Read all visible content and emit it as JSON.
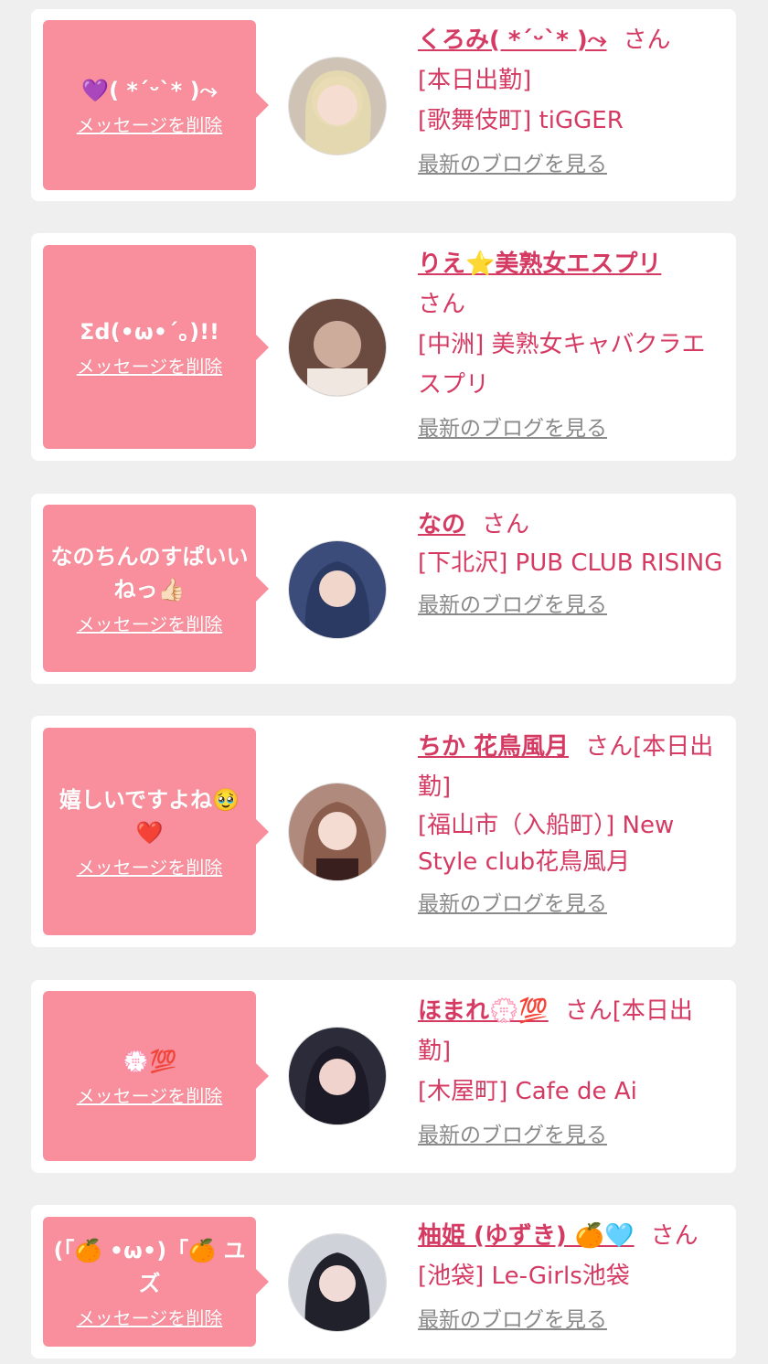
{
  "delete_label": "メッセージを削除",
  "blog_label": "最新のブログを見る",
  "honorific": "さん",
  "colors": {
    "background": "#efefef",
    "bubble": "#f98f9d",
    "accent": "#d53a63",
    "link_gray": "#8a8a8a"
  },
  "messages": [
    {
      "message": "💜( *ˊᵕˋ* )⤳",
      "name": "くろみ( *ˊᵕˋ* )⤳",
      "status": "[本日出勤]",
      "shop": "[歌舞伎町] tiGGER"
    },
    {
      "message": "Σd(•ω•´。)!!",
      "name": "りえ⭐美熟女エスプリ",
      "status": "",
      "shop": "[中洲] 美熟女キャバクラエスプリ"
    },
    {
      "message": "なのちんのすぱいいねっ👍🏻",
      "name": "なの",
      "status": "",
      "shop": "[下北沢] PUB CLUB RISING"
    },
    {
      "message": "嬉しいですよね🥹❤️",
      "name": "ちか 花鳥風月",
      "status": "[本日出勤]",
      "shop": "[福山市（入船町）] New Style club花鳥風月"
    },
    {
      "message": "💮💯",
      "name": "ほまれ💮💯",
      "status": "[本日出勤]",
      "shop": "[木屋町] Cafe de Ai"
    },
    {
      "message": "(「🍊 •ω•)「🍊 ユズ",
      "name": "柚姫 (ゆずき) 🍊🩵",
      "status": "",
      "shop": "[池袋] Le-Girls池袋"
    }
  ]
}
